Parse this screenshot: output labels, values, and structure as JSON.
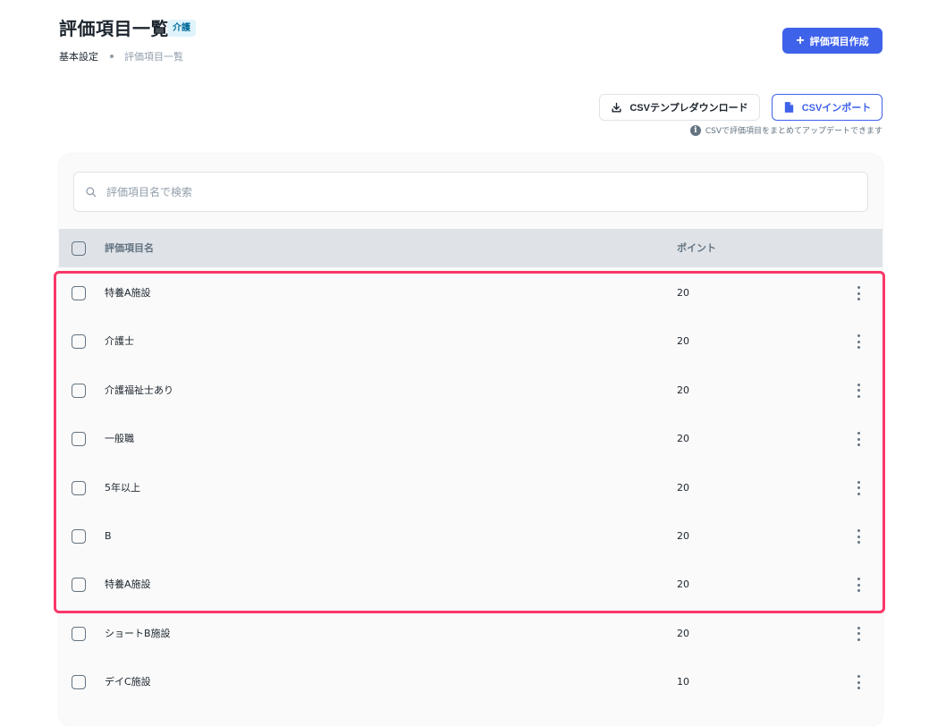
{
  "header": {
    "title": "評価項目一覧",
    "badge": "介護",
    "breadcrumb": [
      "基本設定",
      "評価項目一覧"
    ],
    "create_button_label": "評価項目作成"
  },
  "csv": {
    "download_label": "CSVテンプレダウンロード",
    "import_label": "CSVインポート",
    "note": "CSVで評価項目をまとめてアップデートできます"
  },
  "search": {
    "placeholder": "評価項目名で検索",
    "value": ""
  },
  "table": {
    "columns": {
      "name": "評価項目名",
      "points": "ポイント"
    },
    "rows": [
      {
        "name": "特養A施設",
        "points": "20"
      },
      {
        "name": "介護士",
        "points": "20"
      },
      {
        "name": "介護福祉士あり",
        "points": "20"
      },
      {
        "name": "一般職",
        "points": "20"
      },
      {
        "name": "5年以上",
        "points": "20"
      },
      {
        "name": "B",
        "points": "20"
      },
      {
        "name": "特養A施設",
        "points": "20"
      },
      {
        "name": "ショートB施設",
        "points": "20"
      },
      {
        "name": "デイC施設",
        "points": "10"
      }
    ]
  },
  "colors": {
    "primary": "#3f62ea",
    "highlight": "#fa3769",
    "header_bg": "#dfe3e8"
  },
  "icons": {
    "create": "plus-icon",
    "download": "download-icon",
    "import": "file-icon",
    "info": "info-icon",
    "search": "search-icon",
    "row_menu": "more-vertical-icon"
  }
}
